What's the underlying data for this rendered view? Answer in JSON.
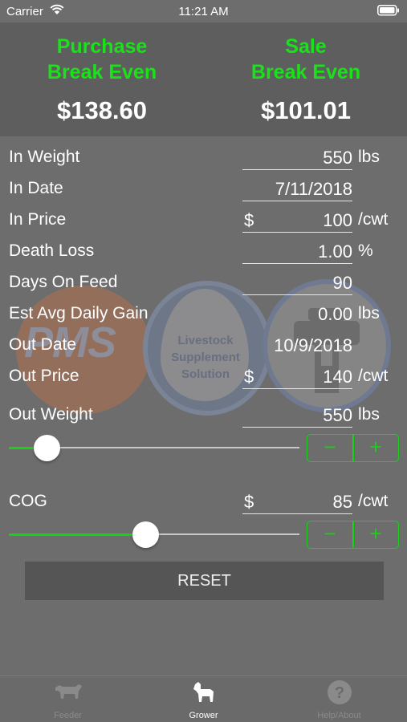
{
  "status_bar": {
    "carrier": "Carrier",
    "time": "11:21 AM"
  },
  "header": {
    "purchase": {
      "line1": "Purchase",
      "line2": "Break Even",
      "value": "$138.60"
    },
    "sale": {
      "line1": "Sale",
      "line2": "Break Even",
      "value": "$101.01"
    }
  },
  "watermark": {
    "pms_text": "PMS",
    "drop_lines": [
      "Livestock",
      "Supplement",
      "Solution"
    ]
  },
  "fields": {
    "in_weight": {
      "label": "In Weight",
      "value": "550",
      "unit": "lbs"
    },
    "in_date": {
      "label": "In Date",
      "value": "7/11/2018"
    },
    "in_price": {
      "label": "In Price",
      "prefix": "$",
      "value": "100",
      "unit": "/cwt"
    },
    "death_loss": {
      "label": "Death Loss",
      "value": "1.00",
      "unit": "%"
    },
    "days_on_feed": {
      "label": "Days On Feed",
      "value": "90"
    },
    "est_adg": {
      "label": "Est Avg Daily Gain",
      "value": "0.00",
      "unit": "lbs"
    },
    "out_date": {
      "label": "Out Date",
      "value": "10/9/2018"
    },
    "out_price": {
      "label": "Out Price",
      "prefix": "$",
      "value": "140",
      "unit": "/cwt"
    },
    "out_weight": {
      "label": "Out Weight",
      "value": "550",
      "unit": "lbs"
    },
    "cog": {
      "label": "COG",
      "prefix": "$",
      "value": "85",
      "unit": "/cwt"
    }
  },
  "sliders": {
    "out_weight": {
      "fraction": 0.13
    },
    "cog": {
      "fraction": 0.47
    }
  },
  "stepper": {
    "minus": "−",
    "plus": "+"
  },
  "reset_label": "RESET",
  "tabs": [
    {
      "label": "Feeder",
      "icon": "cow-icon",
      "active": false
    },
    {
      "label": "Grower",
      "icon": "calf-icon",
      "active": true
    },
    {
      "label": "Help/About",
      "icon": "question-icon",
      "active": false
    }
  ],
  "colors": {
    "accent": "#19e219",
    "background": "#6d6d6d",
    "header": "#5e5e5e"
  }
}
